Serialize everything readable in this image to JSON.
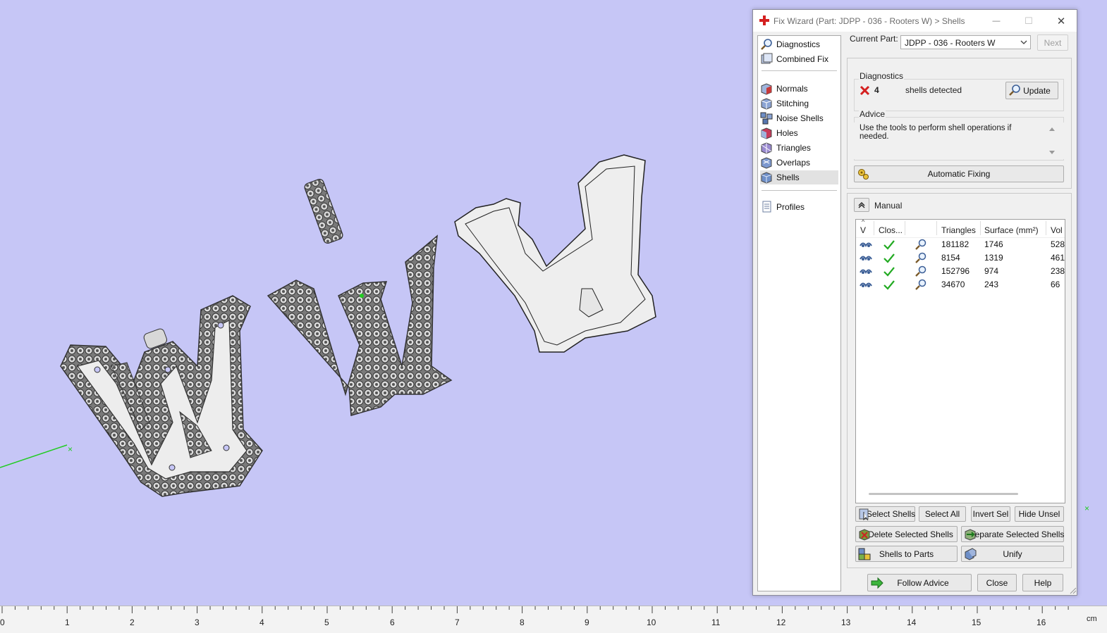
{
  "dialog": {
    "title": "Fix Wizard (Part: JDPP - 036 - Rooters W) > Shells",
    "controls": {
      "minimize": "—",
      "maximize": "☐",
      "close": "✕"
    }
  },
  "nav": {
    "items": [
      {
        "label": "Diagnostics",
        "icon": "magnifier-icon"
      },
      {
        "label": "Combined Fix",
        "icon": "combined-fix-icon"
      },
      {
        "label": "Normals",
        "icon": "normals-cube-icon"
      },
      {
        "label": "Stitching",
        "icon": "stitching-cube-icon"
      },
      {
        "label": "Noise Shells",
        "icon": "noise-shells-icon"
      },
      {
        "label": "Holes",
        "icon": "holes-cube-icon"
      },
      {
        "label": "Triangles",
        "icon": "triangles-cube-icon"
      },
      {
        "label": "Overlaps",
        "icon": "overlaps-cube-icon"
      },
      {
        "label": "Shells",
        "icon": "shells-cube-icon",
        "selected": true
      },
      {
        "label": "Profiles",
        "icon": "profiles-document-icon"
      }
    ]
  },
  "current_part": {
    "label": "Current Part:",
    "value": "JDPP - 036 - Rooters W",
    "next_label": "Next"
  },
  "diagnostics": {
    "section_label": "Diagnostics",
    "count": "4",
    "message": "shells detected",
    "update_label": "Update"
  },
  "advice": {
    "section_label": "Advice",
    "text": "Use the tools to perform shell operations if needed."
  },
  "automatic_fixing_label": "Automatic Fixing",
  "manual": {
    "section_label": "Manual",
    "columns": [
      "V",
      "Clos...",
      "",
      "Triangles",
      "Surface (mm²)",
      "Vol"
    ],
    "rows": [
      {
        "triangles": "181182",
        "surface": "1746",
        "volume": "528"
      },
      {
        "triangles": "8154",
        "surface": "1319",
        "volume": "461"
      },
      {
        "triangles": "152796",
        "surface": "974",
        "volume": "238"
      },
      {
        "triangles": "34670",
        "surface": "243",
        "volume": "66"
      }
    ],
    "buttons": {
      "select_shells": "Select Shells",
      "select_all": "Select All",
      "invert_sel": "Invert Sel",
      "hide_unsel": "Hide Unsel",
      "delete_selected": "Delete Selected Shells",
      "separate_selected": "Separate Selected Shells",
      "shells_to_parts": "Shells to Parts",
      "unify": "Unify"
    }
  },
  "footer": {
    "follow_advice": "Follow Advice",
    "close": "Close",
    "help": "Help"
  },
  "ruler": {
    "labels": [
      "0",
      "1",
      "2",
      "3",
      "4",
      "5",
      "6",
      "7",
      "8",
      "9",
      "10",
      "11",
      "12",
      "13",
      "14",
      "15",
      "16"
    ],
    "unit": "cm"
  },
  "viewport": {
    "background": "#c6c6f6",
    "axis_color": "#22cc22",
    "axis_marker": "×"
  },
  "colors": {
    "accent_red": "#d42020",
    "check_green": "#22aa22",
    "cube_blue": "#6e8fc8"
  }
}
